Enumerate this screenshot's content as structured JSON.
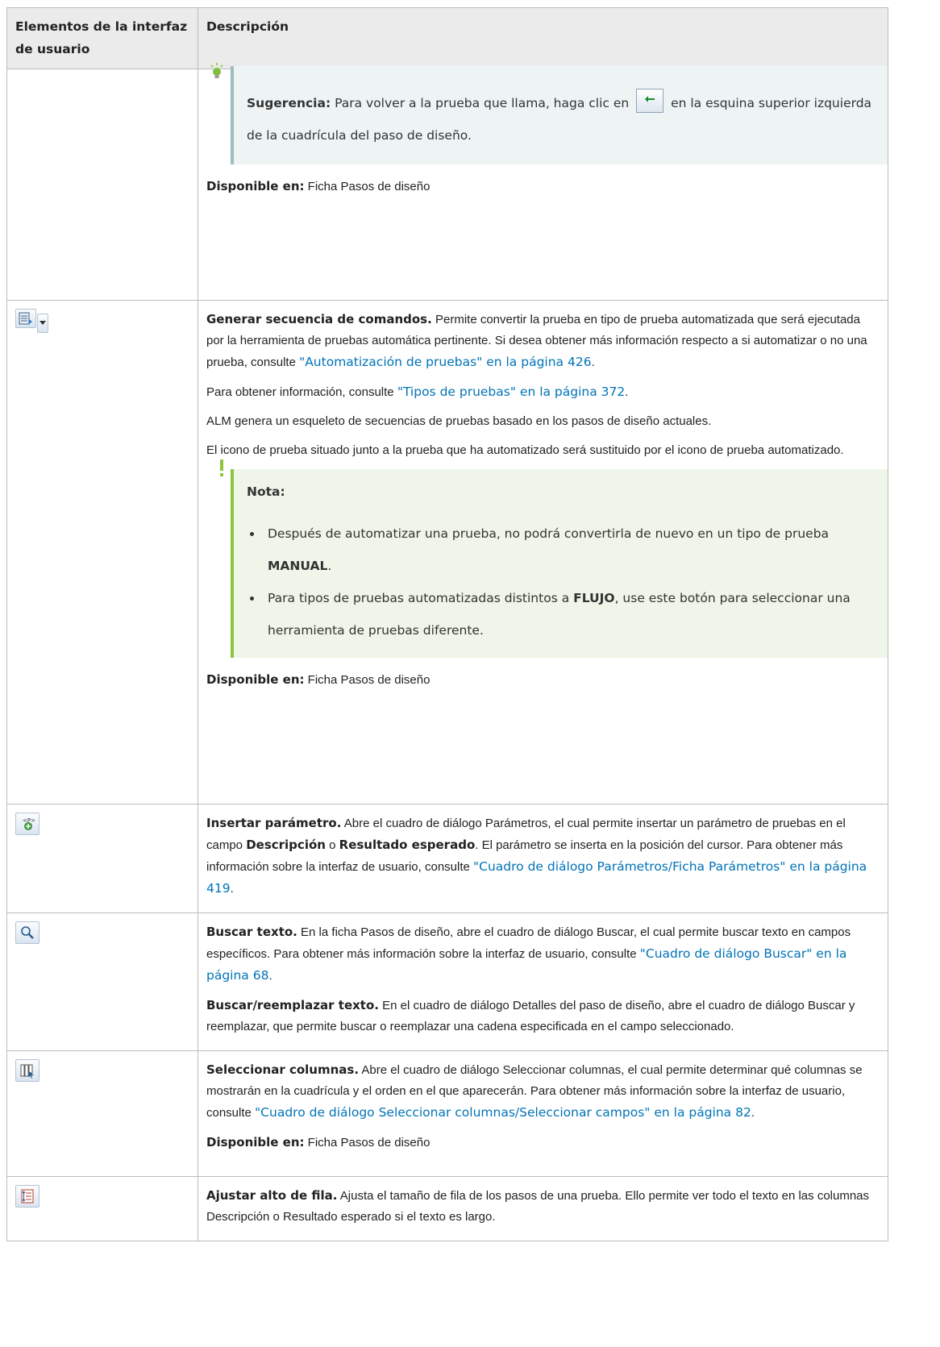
{
  "header": {
    "col1": "Elementos de la interfaz de usuario",
    "col2": "Descripción"
  },
  "row_tip": {
    "tip_label": "Sugerencia:",
    "tip_text_before": " Para volver a la prueba que llama, haga clic en ",
    "tip_text_after": " en la esquina superior izquierda de la cuadrícula del paso de diseño.",
    "avail_label": "Disponible en:",
    "avail_value": " Ficha Pasos de diseño"
  },
  "row_generate": {
    "icon": "generate-script-icon",
    "term": "Generar secuencia de comandos.",
    "p1": " Permite convertir la prueba en tipo de prueba automatizada que será ejecutada por la herramienta de pruebas automática pertinente. Si desea obtener más información respecto a si automatizar o no una prueba, consulte ",
    "p1_link": "\"Automatización de pruebas\" en la página 426",
    "p1_end": ".",
    "p2": "Para obtener información, consulte ",
    "p2_link": "\"Tipos de pruebas\" en la página 372",
    "p2_end": ".",
    "p3": "ALM genera un esqueleto de secuencias de pruebas basado en los pasos de diseño actuales.",
    "p4": "El icono de prueba situado junto a la prueba que ha automatizado será sustituido por el icono de prueba automatizado.",
    "note_title": "Nota:",
    "note_item1_before": "Después de automatizar una prueba, no podrá convertirla de nuevo en un tipo de prueba ",
    "note_item1_bold": "MANUAL",
    "note_item1_after": ".",
    "note_item2_before": "Para tipos de pruebas automatizadas distintos a ",
    "note_item2_bold": "FLUJO",
    "note_item2_after": ", use este botón para seleccionar una herramienta de pruebas diferente.",
    "avail_label": "Disponible en:",
    "avail_value": " Ficha Pasos de diseño"
  },
  "row_param": {
    "icon": "insert-parameter-icon",
    "term": "Insertar parámetro.",
    "t1": " Abre el cuadro de diálogo Parámetros, el cual permite insertar un parámetro de pruebas en el campo ",
    "b1": "Descripción",
    "t2": " o ",
    "b2": "Resultado esperado",
    "t3": ". El parámetro se inserta en la posición del cursor. Para obtener más información sobre la interfaz de usuario, consulte ",
    "link": "\"Cuadro de diálogo Parámetros/Ficha Parámetros\" en la página 419",
    "end": "."
  },
  "row_find": {
    "icon": "find-text-icon",
    "term1": "Buscar texto.",
    "p1": " En la ficha Pasos de diseño, abre el cuadro de diálogo Buscar, el cual permite buscar texto en campos específicos. Para obtener más información sobre la interfaz de usuario, consulte ",
    "p1_link": "\"Cuadro de diálogo Buscar\" en la página 68",
    "p1_end": ".",
    "term2": "Buscar/reemplazar texto.",
    "p2": " En el cuadro de diálogo Detalles del paso de diseño, abre el cuadro de diálogo Buscar y reemplazar, que permite buscar o reemplazar una cadena especificada en el campo seleccionado."
  },
  "row_columns": {
    "icon": "select-columns-icon",
    "term": "Seleccionar columnas.",
    "p1": " Abre el cuadro de diálogo Seleccionar columnas, el cual permite determinar qué columnas se mostrarán en la cuadrícula y el orden en el que aparecerán. Para obtener más información sobre la interfaz de usuario, consulte ",
    "p1_link": "\"Cuadro de diálogo Seleccionar columnas/Seleccionar campos\" en la página 82",
    "p1_end": ".",
    "avail_label": "Disponible en:",
    "avail_value": " Ficha Pasos de diseño"
  },
  "row_height": {
    "icon": "adjust-row-height-icon",
    "term": "Ajustar alto de fila.",
    "p1": " Ajusta el tamaño de fila de los pasos de una prueba. Ello permite ver todo el texto en las columnas Descripción o Resultado esperado si el texto es largo."
  }
}
